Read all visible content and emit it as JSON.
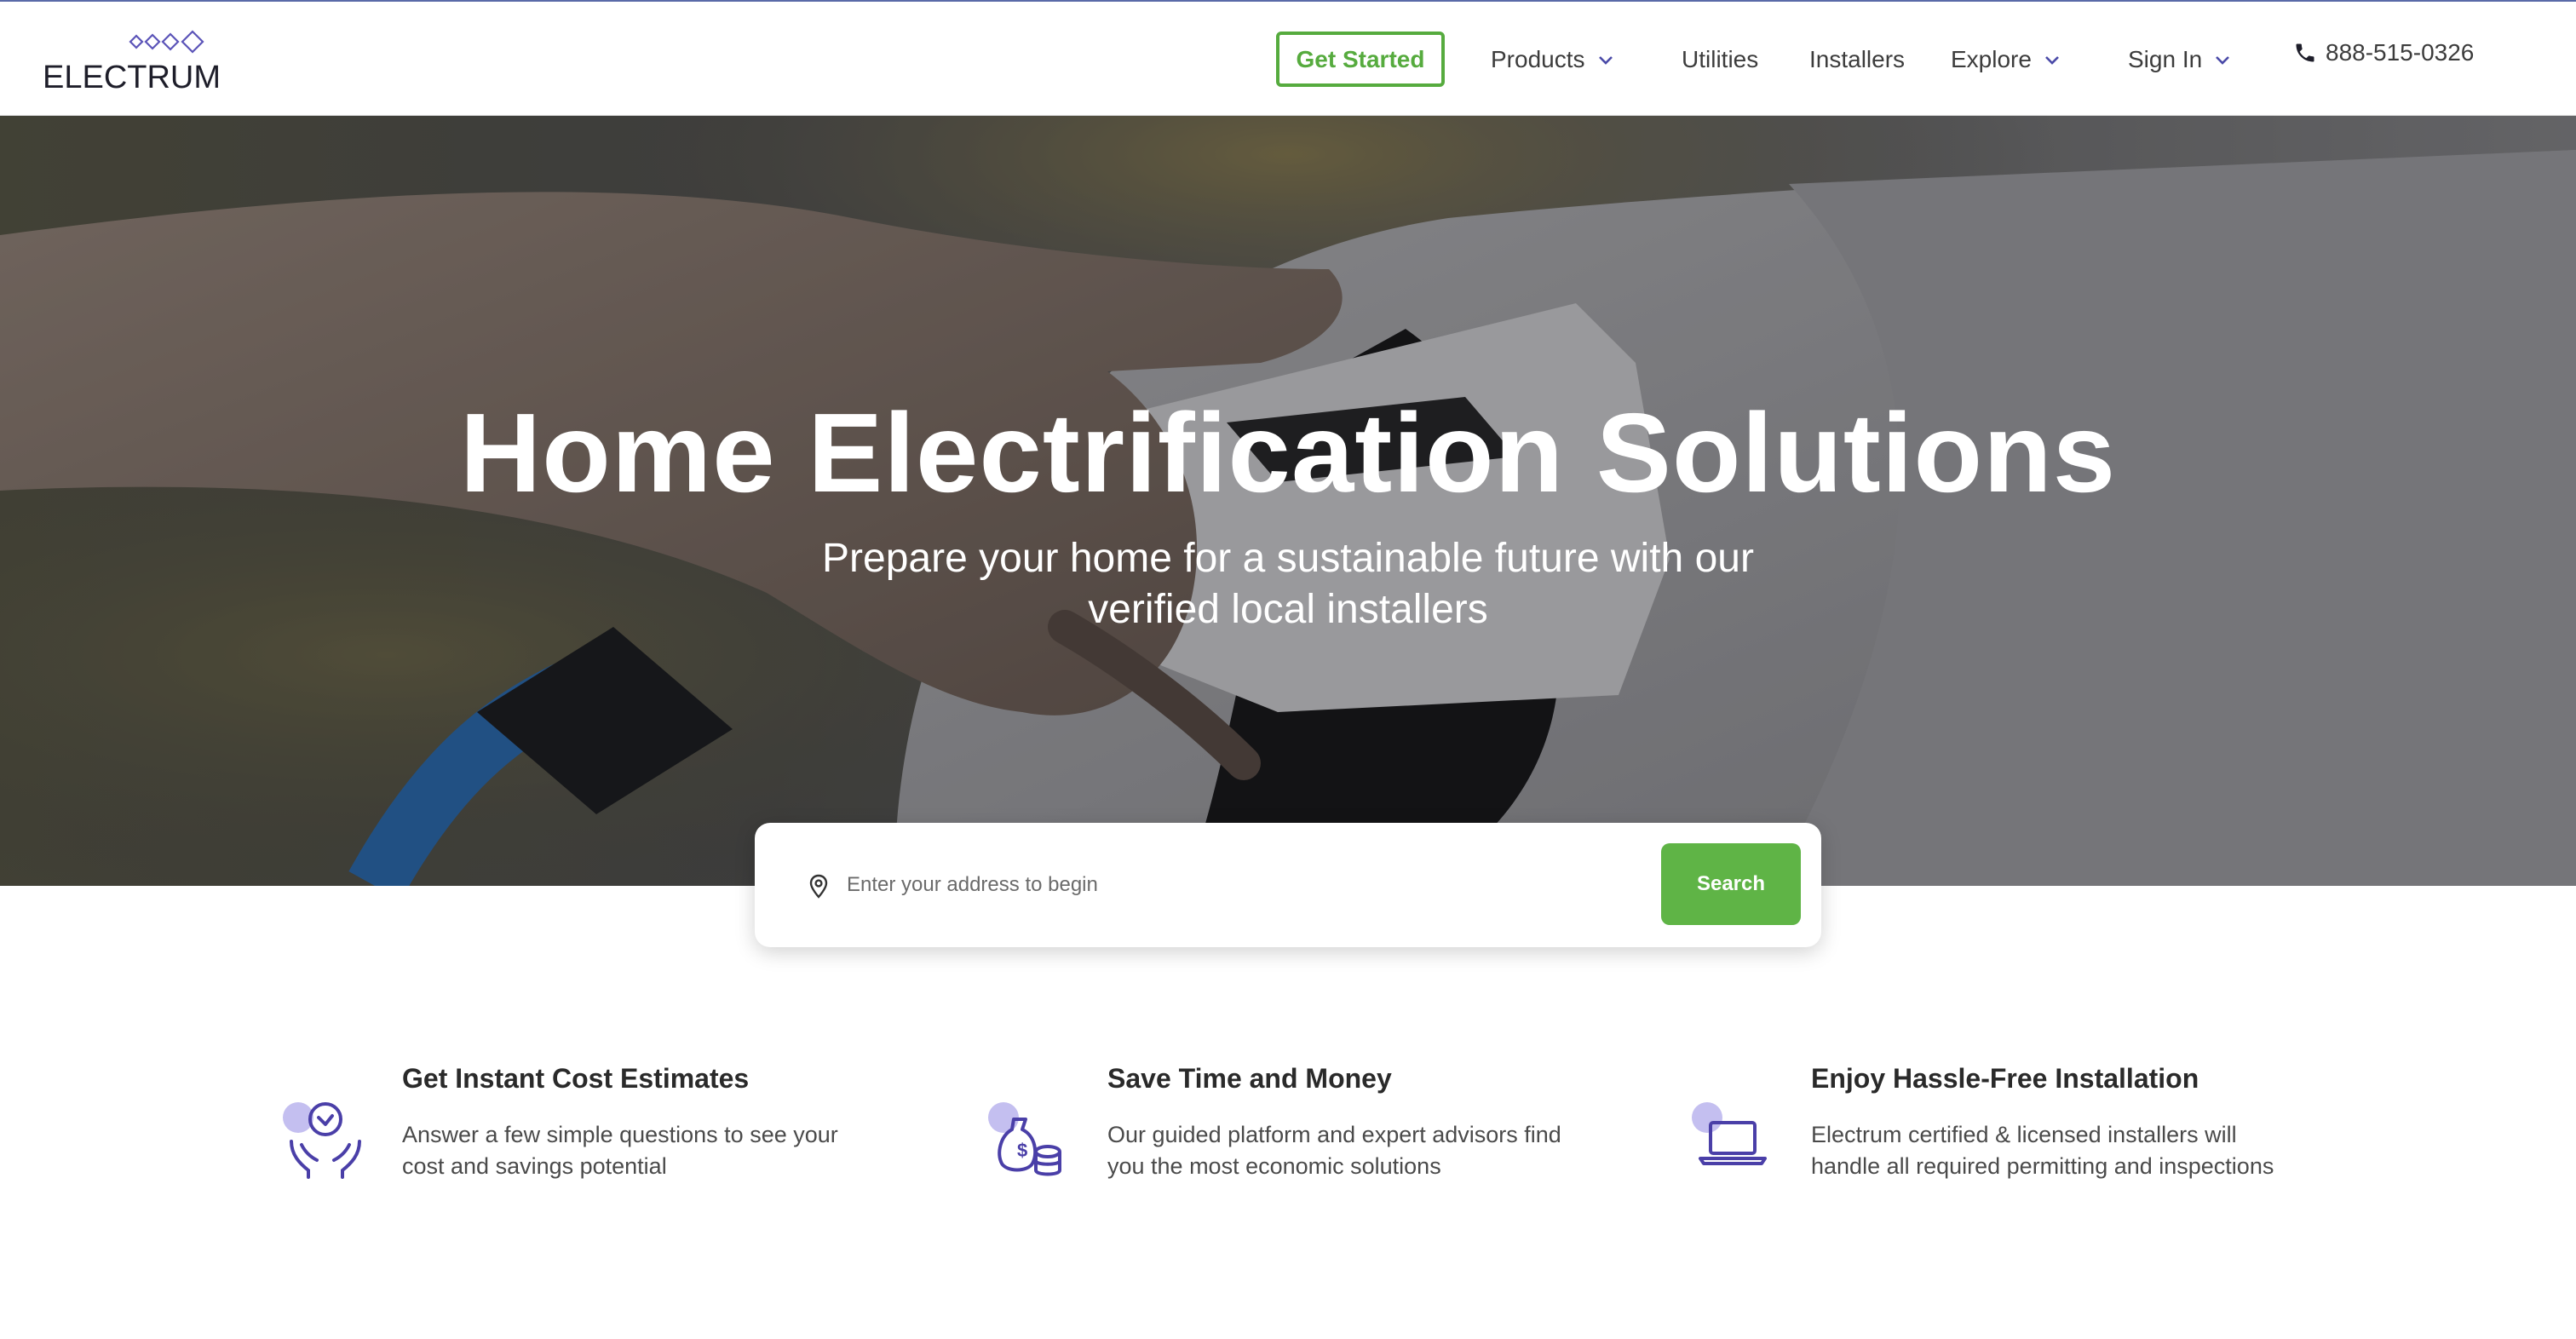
{
  "brand": {
    "name": "ELECTRUM"
  },
  "nav": {
    "get_started": "Get Started",
    "products": "Products",
    "utilities": "Utilities",
    "installers": "Installers",
    "explore": "Explore",
    "sign_in": "Sign In",
    "phone": "888-515-0326"
  },
  "hero": {
    "title": "Home Electrification Solutions",
    "subtitle": "Prepare your home for a sustainable future with our verified local installers"
  },
  "search": {
    "placeholder": "Enter your address to begin",
    "button": "Search"
  },
  "features": [
    {
      "title": "Get Instant Cost Estimates",
      "text": "Answer a few simple questions to see your cost and savings potential",
      "icon": "hands-clock-icon"
    },
    {
      "title": "Save Time and Money",
      "text": "Our guided platform and expert advisors find you the most economic solutions",
      "icon": "money-bag-icon"
    },
    {
      "title": "Enjoy Hassle-Free Installation",
      "text": "Electrum certified & licensed installers will handle all required permitting and inspections",
      "icon": "laptop-icon"
    }
  ],
  "colors": {
    "accent_green": "#5fb446",
    "icon_purple": "#4a3fa8",
    "icon_highlight": "#c4bff0"
  }
}
